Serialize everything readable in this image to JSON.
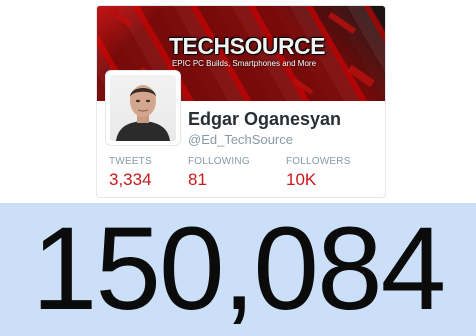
{
  "profile_card": {
    "banner": {
      "brand_title": "TECHSOURCE",
      "brand_subtitle": "EPIC PC Builds, Smartphones and More",
      "accent_color": "#b80f0f"
    },
    "avatar_icon": "person-photo",
    "name": "Edgar Oganesyan",
    "handle": "@Ed_TechSource",
    "stats": [
      {
        "label": "TWEETS",
        "value": "3,334"
      },
      {
        "label": "FOLLOWING",
        "value": "81"
      },
      {
        "label": "FOLLOWERS",
        "value": "10K"
      }
    ],
    "stat_value_color": "#cc1818"
  },
  "counter": {
    "value": "150,084",
    "background": "#cbdff8"
  }
}
